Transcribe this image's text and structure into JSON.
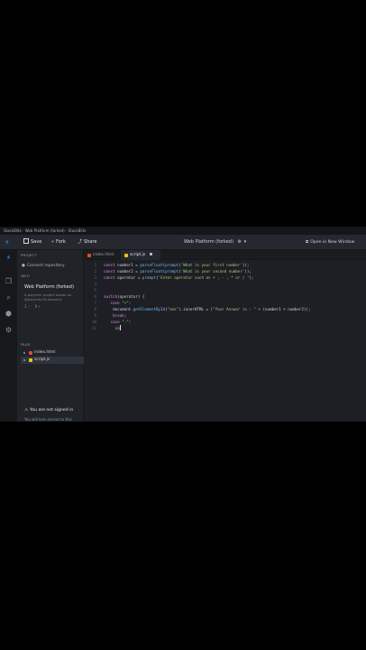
{
  "window": {
    "title": "StackBlitz - Web Platform (forked) - StackBlitz"
  },
  "toolbar": {
    "save_label": "Save",
    "fork_label": "Fork",
    "share_label": "Share",
    "project_title": "Web Platform (forked)",
    "open_window_label": "Open in New Window",
    "beta_label": "BETA"
  },
  "sidebar": {
    "project_header": "PROJECT",
    "connect_repo": "Connect repository",
    "info_header": "INFO",
    "project_name": "Web Platform (forked)",
    "project_description": "A polymer project based on @polymer/lit-element",
    "stars": "1",
    "forks": "0",
    "files_header": "FILES",
    "files": [
      {
        "name": "index.html",
        "type": "html",
        "color": "#e44d26"
      },
      {
        "name": "script.js",
        "type": "js",
        "color": "#f0c419"
      }
    ],
    "signin_warning": "You are not signed in",
    "signin_sub": "You will lose access to this"
  },
  "editor": {
    "tabs": [
      {
        "name": "index.html",
        "active": false,
        "color": "#e44d26"
      },
      {
        "name": "script.js",
        "active": true,
        "color": "#f0c419",
        "modified": true
      }
    ],
    "lines": [
      {
        "n": "1",
        "text": "const number1 = parseFloat(prompt('What is your first number'));"
      },
      {
        "n": "2",
        "text": "const number2 = parseFloat(prompt('What is your second number'));"
      },
      {
        "n": "3",
        "text": "const operator = prompt('Enter operator such as + , - , * or / ');"
      },
      {
        "n": "4",
        "text": ""
      },
      {
        "n": "5",
        "text": ""
      },
      {
        "n": "6",
        "text": "switch(operator) {"
      },
      {
        "n": "7",
        "text": "   case \"+\":"
      },
      {
        "n": "8",
        "text": "    document.getElementById(\"ans\").innerHTML = (\"Your Answer is : \" + (number1 + number2));"
      },
      {
        "n": "9",
        "text": "    break;"
      },
      {
        "n": "10",
        "text": "   case \"-\":"
      },
      {
        "n": "11",
        "text": "     in"
      }
    ]
  }
}
